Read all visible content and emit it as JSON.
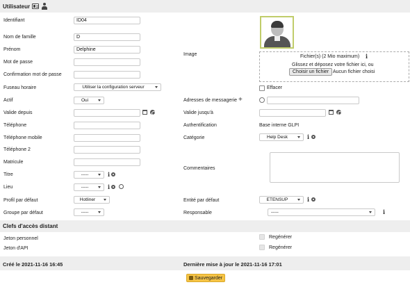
{
  "header": {
    "title": "Utilisateur",
    "icon_vcard": "vcard-icon",
    "icon_person": "person-icon"
  },
  "fields": {
    "identifiant": {
      "label": "Identifiant",
      "value": "ID04"
    },
    "nom": {
      "label": "Nom de famille",
      "value": "D"
    },
    "prenom": {
      "label": "Prénom",
      "value": "Delphine"
    },
    "password": {
      "label": "Mot de passe",
      "value": ""
    },
    "password_confirm": {
      "label": "Confirmation mot de passe",
      "value": ""
    },
    "timezone": {
      "label": "Fuseau horaire",
      "value": "Utiliser la configuration serveur"
    },
    "actif": {
      "label": "Actif",
      "value": "Oui"
    },
    "valide_depuis": {
      "label": "Valide depuis",
      "value": ""
    },
    "telephone": {
      "label": "Téléphone",
      "value": ""
    },
    "telephone_mobile": {
      "label": "Téléphone mobile",
      "value": ""
    },
    "telephone2": {
      "label": "Téléphone 2",
      "value": ""
    },
    "matricule": {
      "label": "Matricule",
      "value": ""
    },
    "titre": {
      "label": "Titre",
      "value": "-----"
    },
    "lieu": {
      "label": "Lieu",
      "value": "-----"
    },
    "profil": {
      "label": "Profil par défaut",
      "value": "Hotliner"
    },
    "groupe": {
      "label": "Groupe par défaut",
      "value": "-----"
    },
    "image": {
      "label": "Image"
    },
    "adresses": {
      "label": "Adresses de messagerie",
      "value": ""
    },
    "valide_jusqu": {
      "label": "Valide jusqu'à",
      "value": ""
    },
    "authentification": {
      "label": "Authentification",
      "value": "Base interne GLPI"
    },
    "categorie": {
      "label": "Catégorie",
      "value": "Help Desk"
    },
    "commentaires": {
      "label": "Commentaires",
      "value": ""
    },
    "entite": {
      "label": "Entité par défaut",
      "value": "ETENSUP"
    },
    "responsable": {
      "label": "Responsable",
      "value": "-----"
    }
  },
  "upload": {
    "title": "Fichier(s) (2 Mio maximum)",
    "drop_text": "Glissez et déposez votre fichier ici, ou",
    "choose_button": "Choisir un fichier",
    "no_file": "Aucun fichier choisi",
    "erase_label": "Effacer"
  },
  "remote_keys": {
    "title": "Clefs d'accès distant",
    "jeton_personnel": "Jeton personnel",
    "jeton_api": "Jeton d'API",
    "regen_label": "Regénérer"
  },
  "footer": {
    "created": "Créé le 2021-11-16 16:45",
    "updated": "Dernière mise à jour le 2021-11-16 17:01",
    "save_button": "Sauvegarder"
  },
  "colors": {
    "band": "#eeeeee",
    "save_button": "#f6c445",
    "avatar_border": "#c0cd6a"
  }
}
